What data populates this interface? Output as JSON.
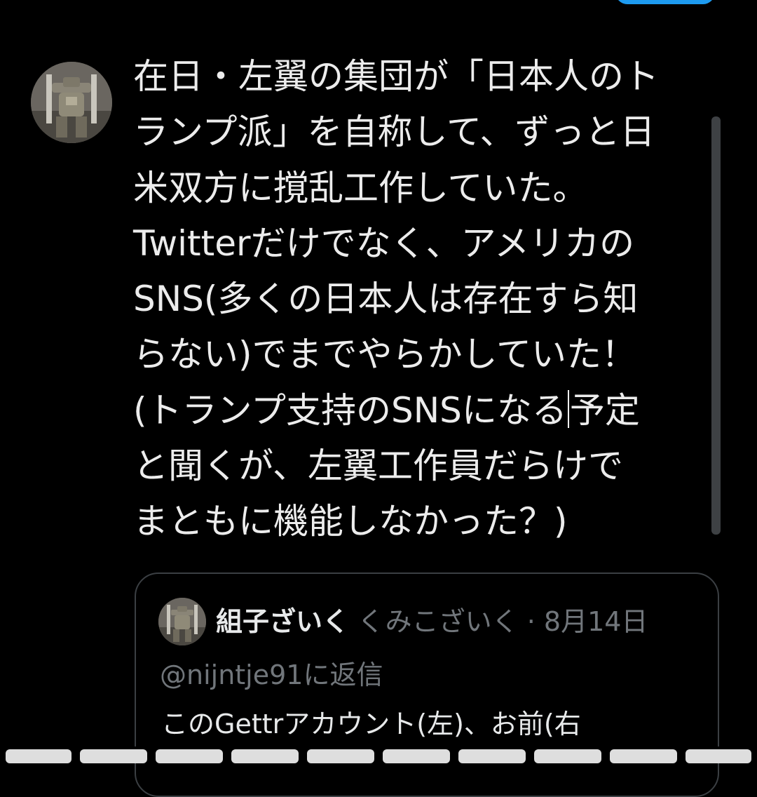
{
  "composer": {
    "lines": [
      "在日・左翼の集団が「日本人のト",
      "ランプ派」を自称して、ずっと日",
      "米双方に撹乱工作していた。",
      "Twitterだけでなく、アメリカの",
      "SNS(多くの日本人は存在すら知",
      "らない)でまでやらかしていた！",
      "(トランプ支持のSNSになる",
      "予定",
      "と聞くが、左翼工作員だらけで",
      "まともに機能しなかった？)"
    ]
  },
  "quoted_tweet": {
    "display_name": "組子ざいく",
    "handle": "くみこざいく",
    "separator": " · ",
    "date": "8月14日",
    "reply_to": "@nijntje91に返信",
    "text": "このGettrアカウント(左)、お前(右"
  },
  "icons": {
    "avatar": "mecha-avatar-image",
    "quoted_avatar": "mecha-avatar-image"
  },
  "colors": {
    "background": "#000000",
    "text_primary": "#e7e9ea",
    "text_secondary": "#71767b",
    "accent": "#1d9bf0",
    "border": "#3b3f43"
  }
}
